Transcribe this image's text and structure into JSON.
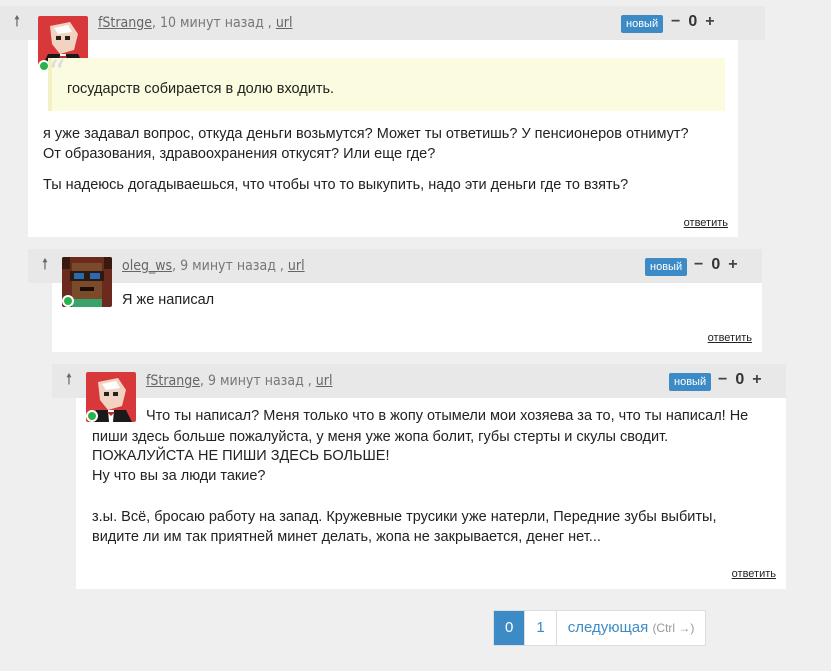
{
  "comments": [
    {
      "author": "fStrange",
      "time": ", 10 минут назад , ",
      "url_label": "url",
      "badge": "новый",
      "score": "0",
      "quote": "государств собирается в долю входить.",
      "lines": [
        " я уже задавал вопрос, откуда деньги возьмутся? Может ты ответишь? У пенсионеров отнимут?",
        "От образования, здравоохранения откусят? Или еще где?",
        "Ты надеюсь догадываешься, что чтобы что то выкупить, надо эти деньги где то взять?"
      ],
      "reply": "ответить"
    },
    {
      "author": "oleg_ws",
      "time": ", 9 минут назад , ",
      "url_label": "url",
      "badge": "новый",
      "score": "0",
      "lines": [
        "Я же написал"
      ],
      "reply": "ответить"
    },
    {
      "author": "fStrange",
      "time": ", 9 минут назад , ",
      "url_label": "url",
      "badge": "новый",
      "score": "0",
      "lines": [
        "Что ты написал? Меня только что в жопу отымели мои хозяева за то, что ты написал! Не",
        "пиши здесь больше пожалуйста, у меня уже жопа болит, губы стерты и скулы сводит.",
        "ПОЖАЛУЙСТА НЕ ПИШИ ЗДЕСЬ БОЛЬШЕ!",
        "Ну что вы за люди такие?",
        "з.ы. Всё, бросаю работу на запад. Кружевные трусики уже натерли, Передние зубы выбиты,",
        "видите ли им так приятней минет делать, жопа не закрывается, денег нет..."
      ],
      "reply": "ответить"
    }
  ],
  "pagination": {
    "pages": [
      "0",
      "1"
    ],
    "next_label": "следующая",
    "next_hint": "(Ctrl →)"
  },
  "icons": {
    "vote_up": "arrow-up-icon",
    "minus": "minus-icon",
    "plus": "plus-icon",
    "online": "online-check-icon"
  },
  "colors": {
    "badge": "#3d8bc6",
    "quote_bg": "#fbfbe0",
    "online": "#2bb24c"
  }
}
